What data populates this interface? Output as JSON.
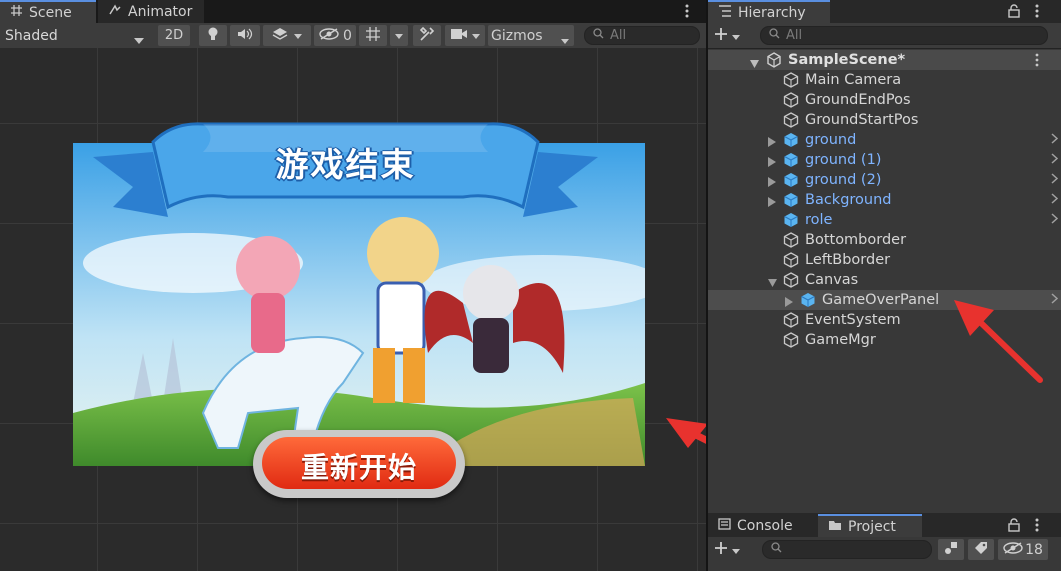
{
  "scene_tabs": {
    "scene": "Scene",
    "animator": "Animator"
  },
  "scene_toolbar": {
    "shading_mode": "Shaded",
    "mode_2d": "2D",
    "hidden_count": "0",
    "gizmos": "Gizmos",
    "search_placeholder": "All"
  },
  "game_over_panel": {
    "banner_title": "游戏结束",
    "restart_button": "重新开始"
  },
  "hierarchy": {
    "tab_label": "Hierarchy",
    "search_placeholder": "All",
    "scene_name": "SampleScene*",
    "items": [
      {
        "label": "Main Camera",
        "prefab": false,
        "foldout": "none"
      },
      {
        "label": "GroundEndPos",
        "prefab": false,
        "foldout": "none"
      },
      {
        "label": "GroundStartPos",
        "prefab": false,
        "foldout": "none"
      },
      {
        "label": "ground",
        "prefab": true,
        "foldout": "collapsed"
      },
      {
        "label": "ground (1)",
        "prefab": true,
        "foldout": "collapsed"
      },
      {
        "label": "ground (2)",
        "prefab": true,
        "foldout": "collapsed"
      },
      {
        "label": "Background",
        "prefab": true,
        "foldout": "collapsed"
      },
      {
        "label": "role",
        "prefab": true,
        "foldout": "none"
      },
      {
        "label": "Bottomborder",
        "prefab": false,
        "foldout": "none"
      },
      {
        "label": "LeftBborder",
        "prefab": false,
        "foldout": "none"
      },
      {
        "label": "Canvas",
        "prefab": false,
        "foldout": "expanded"
      },
      {
        "label": "GameOverPanel",
        "prefab": false,
        "foldout": "collapsed",
        "selected": true
      },
      {
        "label": "EventSystem",
        "prefab": false,
        "foldout": "none"
      },
      {
        "label": "GameMgr",
        "prefab": false,
        "foldout": "none"
      }
    ]
  },
  "bottom_panel": {
    "console_tab": "Console",
    "project_tab": "Project",
    "hidden_count": "18"
  },
  "colors": {
    "accent_blue": "#5a8fe0",
    "prefab_text": "#7fb4ff",
    "arrow_red": "#e8322e",
    "button_red": "#e83a1c"
  }
}
